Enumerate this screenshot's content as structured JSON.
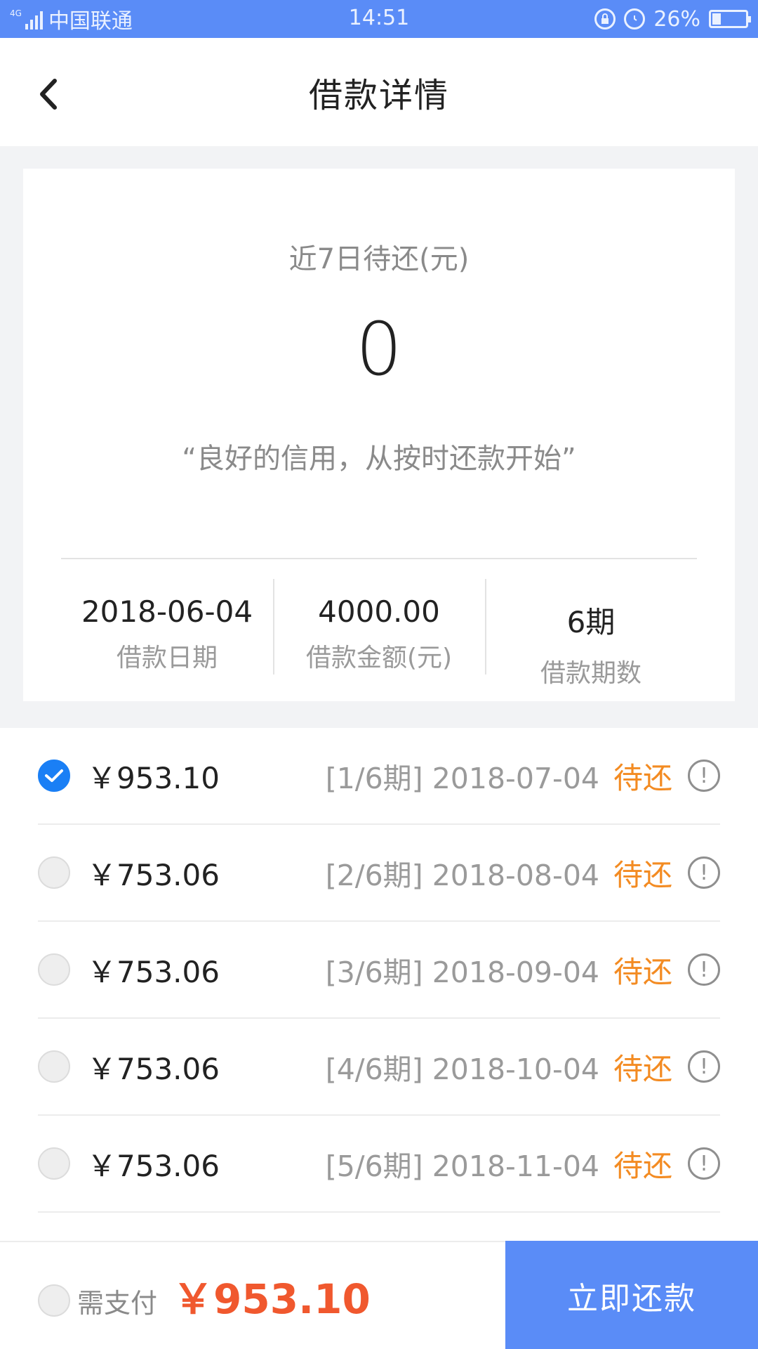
{
  "status_bar": {
    "network": "4G",
    "carrier": "中国联通",
    "time": "14:51",
    "battery": "26%",
    "battery_level": 0.26,
    "icons": [
      "signal-icon",
      "lock-rotation-icon",
      "alarm-icon",
      "battery-icon"
    ]
  },
  "header": {
    "title": "借款详情",
    "back_icon": "chevron-left-icon"
  },
  "summary": {
    "due_label": "近7日待还(元)",
    "due_value": "0",
    "slogan": "“良好的信用，从按时还款开始”",
    "stats": [
      {
        "value": "2018-06-04",
        "label": "借款日期"
      },
      {
        "value": "4000.00",
        "label": "借款金额(元)"
      },
      {
        "value": "6期",
        "label": "借款期数"
      }
    ]
  },
  "installments": [
    {
      "amount": "￥953.10",
      "period": "[1/6期] 2018-07-04",
      "status": "待还",
      "checked": true
    },
    {
      "amount": "￥753.06",
      "period": "[2/6期] 2018-08-04",
      "status": "待还",
      "checked": false
    },
    {
      "amount": "￥753.06",
      "period": "[3/6期] 2018-09-04",
      "status": "待还",
      "checked": false
    },
    {
      "amount": "￥753.06",
      "period": "[4/6期] 2018-10-04",
      "status": "待还",
      "checked": false
    },
    {
      "amount": "￥753.06",
      "period": "[5/6期] 2018-11-04",
      "status": "待还",
      "checked": false
    }
  ],
  "footer": {
    "pay_label": "需支付",
    "pay_amount": "￥953.10",
    "pay_button": "立即还款"
  },
  "colors": {
    "accent": "#5a8cf7",
    "checked": "#1a7ff5",
    "pending": "#f38b22",
    "price": "#f0582e"
  }
}
